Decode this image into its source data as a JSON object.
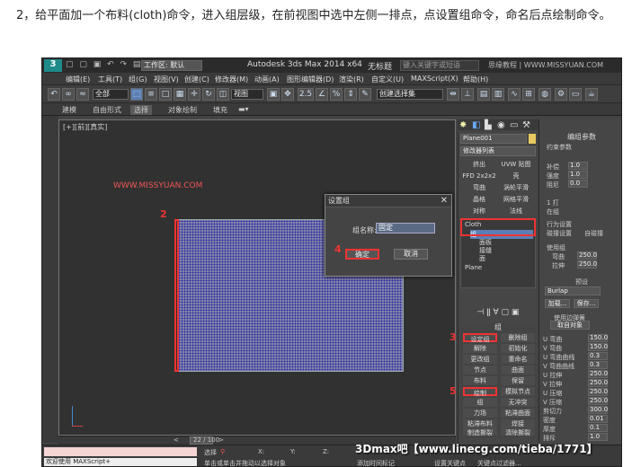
{
  "caption": "2，给平面加一个布料(cloth)命令，进入组层级，在前视图中选中左侧一排点，点设置组命令，命名后点绘制命令。",
  "titlebar": {
    "app_icon": "3",
    "workspace": "工作区: 默认",
    "title": "Autodesk 3ds Max  2014 x64",
    "document": "无标题",
    "search_placeholder": "键入关键字或短语",
    "watermark": "思缘教程 | WWW.MISSYUAN.COM"
  },
  "menus": [
    "编辑(E)",
    "工具(T)",
    "组(G)",
    "视图(V)",
    "创建(C)",
    "修改器(M)",
    "动画(A)",
    "图形编辑器(D)",
    "渲染(R)",
    "自定义(U)",
    "MAXScript(X)",
    "帮助(H)"
  ],
  "toolbar": {
    "selection_filter": "全部",
    "coord_system": "视图",
    "snap_value": "2.5",
    "named_sets": "创建选择集"
  },
  "ribbon": {
    "tabs": [
      "建模",
      "自由形式",
      "选择",
      "对象绘制",
      "填充"
    ],
    "active": "选择"
  },
  "viewport": {
    "label": "[+][前][真实]",
    "watermark": "WWW.MISSYUAN.COM"
  },
  "dialog": {
    "title": "设置组",
    "close": "✕",
    "name_label": "组名称:",
    "name_value": "固定",
    "ok": "确定",
    "cancel": "取消"
  },
  "annotations": {
    "n2": "2",
    "n3": "3",
    "n4": "4",
    "n5": "5"
  },
  "command_panel": {
    "object_name": "Plane001",
    "modifier_list": "修改器列表",
    "modifier_buttons": [
      "挤出",
      "UVW 贴图",
      "FFD 2x2x2",
      "壳",
      "弯曲",
      "涡轮平滑",
      "晶格",
      "网格平滑",
      "对称",
      "法线"
    ],
    "stack": {
      "cloth": "Cloth",
      "items": [
        "组",
        "面板",
        "接缝",
        "面"
      ],
      "plane": "Plane"
    },
    "group_panel": {
      "title": "组",
      "buttons": [
        "设定组",
        "删除组",
        "解除",
        "初始化",
        "更改组",
        "重命名",
        "节点",
        "曲面",
        "布料",
        "保留",
        "绘制",
        "模拟节点",
        "组",
        "无冲突",
        "力场",
        "粘滞曲面",
        "粘滞布料",
        "焊接",
        "制造撕裂",
        "清除撕裂"
      ]
    }
  },
  "params": {
    "title": "编组参数",
    "constraint": "约束参数",
    "labels": [
      "补偿",
      "强度",
      "阻尼",
      "1 打",
      "在组",
      "行为设置",
      "碰撞设置",
      "自碰撞",
      "使用组",
      "弯曲",
      "拉伸",
      "预设"
    ],
    "values": [
      "1.0",
      "1.0",
      "0.0",
      "250.0"
    ],
    "preset": "Burlap",
    "load": "加载...",
    "save": "保存...",
    "use_edge": "使用边弹簧",
    "get": "取自对象",
    "attr_labels": [
      "U 弯曲",
      "V 弯曲",
      "U 弯曲曲线",
      "V 弯曲曲线",
      "U 拉伸",
      "V 拉伸",
      "U 压缩",
      "V 压缩",
      "剪切力",
      "密度",
      "厚度",
      "排斥",
      "阻尼",
      "空气阻力"
    ],
    "attr_values": [
      "150.0",
      "150.0",
      "0.3",
      "0.3",
      "250.0",
      "250.0",
      "250.0",
      "250.0",
      "300.0",
      "0.01",
      "0.1",
      "1.0",
      "0.1",
      "0.02"
    ]
  },
  "timeslider": {
    "frame": "22 / 100",
    "prev": "<",
    "next": ">"
  },
  "status": {
    "welcome": "欢迎使用 MAXScript+",
    "hint": "单击或单击并拖动以选择对象",
    "add_time": "添加时间标记",
    "selected": "选择",
    "x": "X:",
    "y": "Y:",
    "z": "Z:",
    "set_key": "设置关键点",
    "key_filter": "关键点过滤器..."
  },
  "big_watermark": "3Dmax吧【www.linecg.com/tieba/1771】",
  "colors": {
    "annotation_red": "#e33333",
    "highlight_blue": "#5b7fb5"
  }
}
